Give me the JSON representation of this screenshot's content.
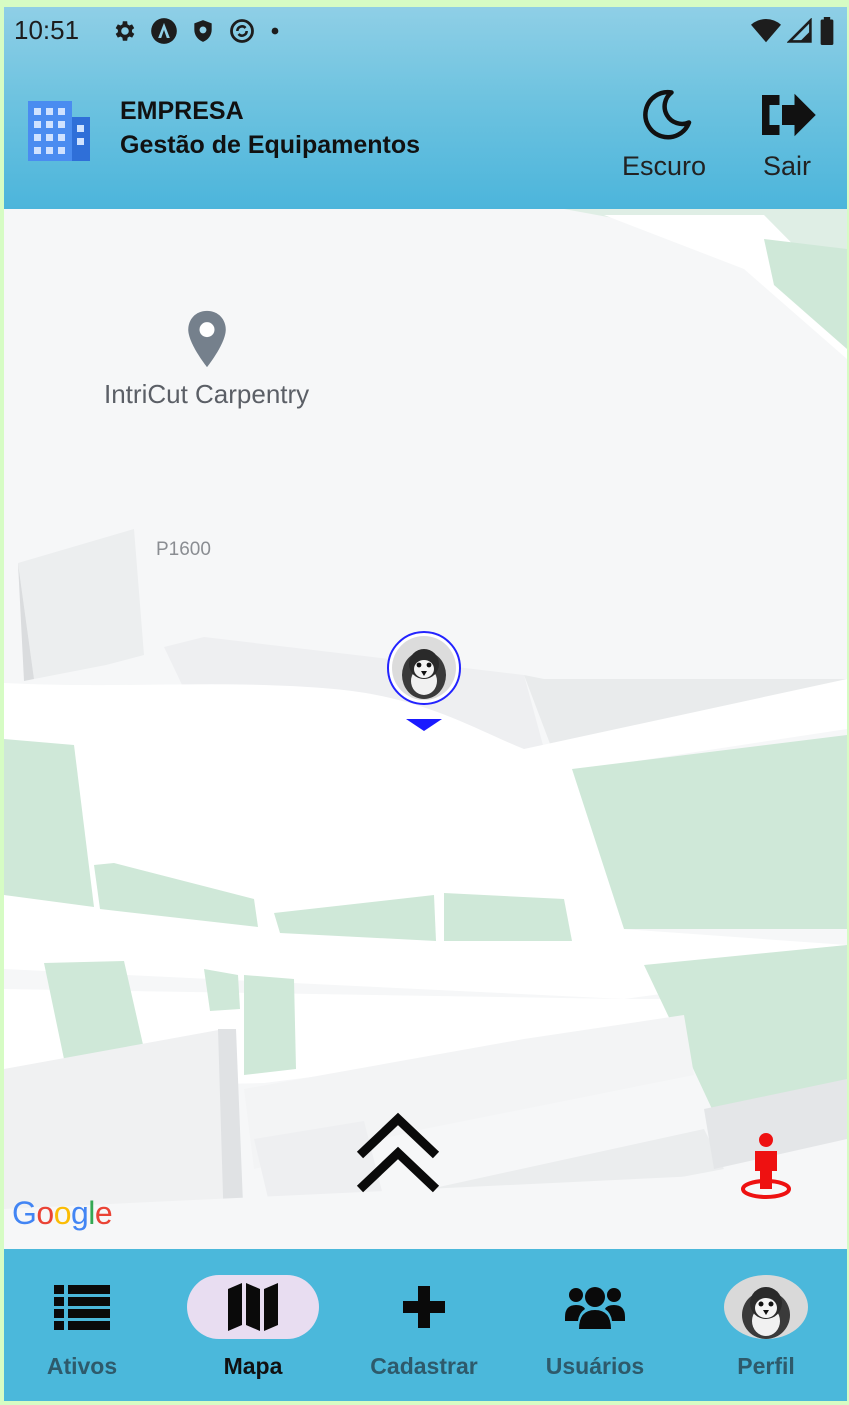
{
  "status_bar": {
    "time": "10:51",
    "left_icons": [
      "gear-icon",
      "android-auto-icon",
      "shield-icon",
      "sync-icon",
      "dot-icon"
    ],
    "right_icons": [
      "wifi-icon",
      "signal-icon",
      "battery-icon"
    ]
  },
  "header": {
    "company": "EMPRESA",
    "subtitle": "Gestão de Equipamentos",
    "logo_icon": "building-icon",
    "dark_label": "Escuro",
    "logout_label": "Sair"
  },
  "map": {
    "poi_name": "IntriCut Carpentry",
    "area_code": "P1600",
    "provider": "Google"
  },
  "bottom_nav": {
    "items": [
      {
        "label": "Ativos",
        "icon": "list-icon",
        "active": false
      },
      {
        "label": "Mapa",
        "icon": "map-icon",
        "active": true
      },
      {
        "label": "Cadastrar",
        "icon": "plus-icon",
        "active": false
      },
      {
        "label": "Usuários",
        "icon": "users-icon",
        "active": false
      },
      {
        "label": "Perfil",
        "icon": "avatar",
        "active": false
      }
    ]
  },
  "colors": {
    "header_top": "#8fcfe6",
    "header_bottom": "#4cb5db",
    "nav_bg": "#4bb8db",
    "nav_active_pill": "#e8ddf1",
    "marker_blue": "#1a1aff",
    "locate_red": "#ee1111",
    "park_green": "#cfe8d8"
  }
}
